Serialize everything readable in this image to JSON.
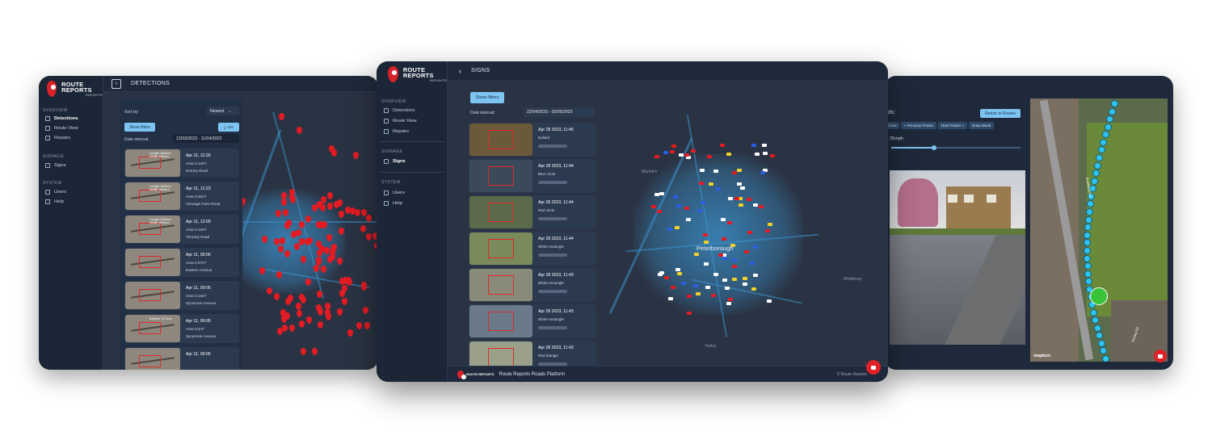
{
  "brand": {
    "name": "ROUTE REPORTS",
    "sub": "INSIGHTS",
    "red": "#d8222a"
  },
  "nav": {
    "sections": {
      "overview": "OVERVIEW",
      "signage": "SIGNAGE",
      "system": "SYSTEM"
    },
    "items": {
      "detections": "Detections",
      "route_view": "Route View",
      "repairs": "Repairs",
      "signs": "Signs",
      "users": "Users",
      "help": "Help"
    }
  },
  "left_screen": {
    "title": "DETECTIONS",
    "sort_label": "Sort by:",
    "sort_value": "Newest",
    "show_filters": "Show filters",
    "csv": "csv",
    "date_label": "Date interval:",
    "date_value": "12/03/2023 - 11/04/2023",
    "cards": [
      {
        "date": "Apr 11, 12:26",
        "area": "Area 0.14m²",
        "street": "Dorney Road",
        "overlay": "Length 469mm Width 290mm"
      },
      {
        "date": "Apr 11, 12:23",
        "area": "Area 0.35m²",
        "street": "Vicarage Farm Road",
        "overlay": "Length 963mm Width 362mm"
      },
      {
        "date": "Apr 11, 12:00",
        "area": "Area 0.12m²",
        "street": "Thorney Road",
        "overlay": "Length 432mm Width 287mm"
      },
      {
        "date": "Apr 11, 09:06",
        "area": "Area 0.07m²",
        "street": "Eastern Avenue",
        "overlay": ""
      },
      {
        "date": "Apr 11, 09:05",
        "area": "Area 0.13m²",
        "street": "Sycamore Avenue",
        "overlay": ""
      },
      {
        "date": "Apr 11, 09:05",
        "area": "Area 0.2m²",
        "street": "Sycamore Avenue",
        "overlay": "845mm 217mm"
      },
      {
        "date": "Apr 11, 09:05",
        "area": "",
        "street": "",
        "overlay": ""
      }
    ]
  },
  "center_screen": {
    "title": "SIGNS",
    "show_filters": "Show filters",
    "date_label": "Date interval:",
    "date_value": "22/04/2023 - 02/05/2023",
    "cards": [
      {
        "date": "Apr 28 2023, 11:46",
        "type": "Bollard"
      },
      {
        "date": "Apr 28 2023, 11:44",
        "type": "Blue circle"
      },
      {
        "date": "Apr 28 2023, 11:44",
        "type": "Red circle"
      },
      {
        "date": "Apr 28 2023, 11:44",
        "type": "White rectangle"
      },
      {
        "date": "Apr 28 2023, 11:43",
        "type": "White rectangle"
      },
      {
        "date": "Apr 28 2023, 11:43",
        "type": "White rectangle"
      },
      {
        "date": "Apr 28 2023, 11:43",
        "type": "Red triangle"
      }
    ],
    "map_labels": {
      "city": "Peterborough",
      "marholm": "Marholm",
      "whittlesey": "Whittlesey",
      "yaxley": "Yaxley"
    },
    "footer_text": "Route Reports Roads Platform",
    "copyright": "© Route Reports"
  },
  "right_screen": {
    "controls_label": "rols:",
    "return_button": "Return to Routes",
    "nav_buttons": {
      "close": "Close",
      "prev": "« Previous Frame",
      "next": "Next Frame »",
      "draw": "Draw Mode"
    },
    "speed": "d: 25mph",
    "map_labels": {
      "s": "S",
      "brookland": "Brookland Ave",
      "stanley": "Stanley Rd",
      "mapbox": "mapbox"
    }
  }
}
